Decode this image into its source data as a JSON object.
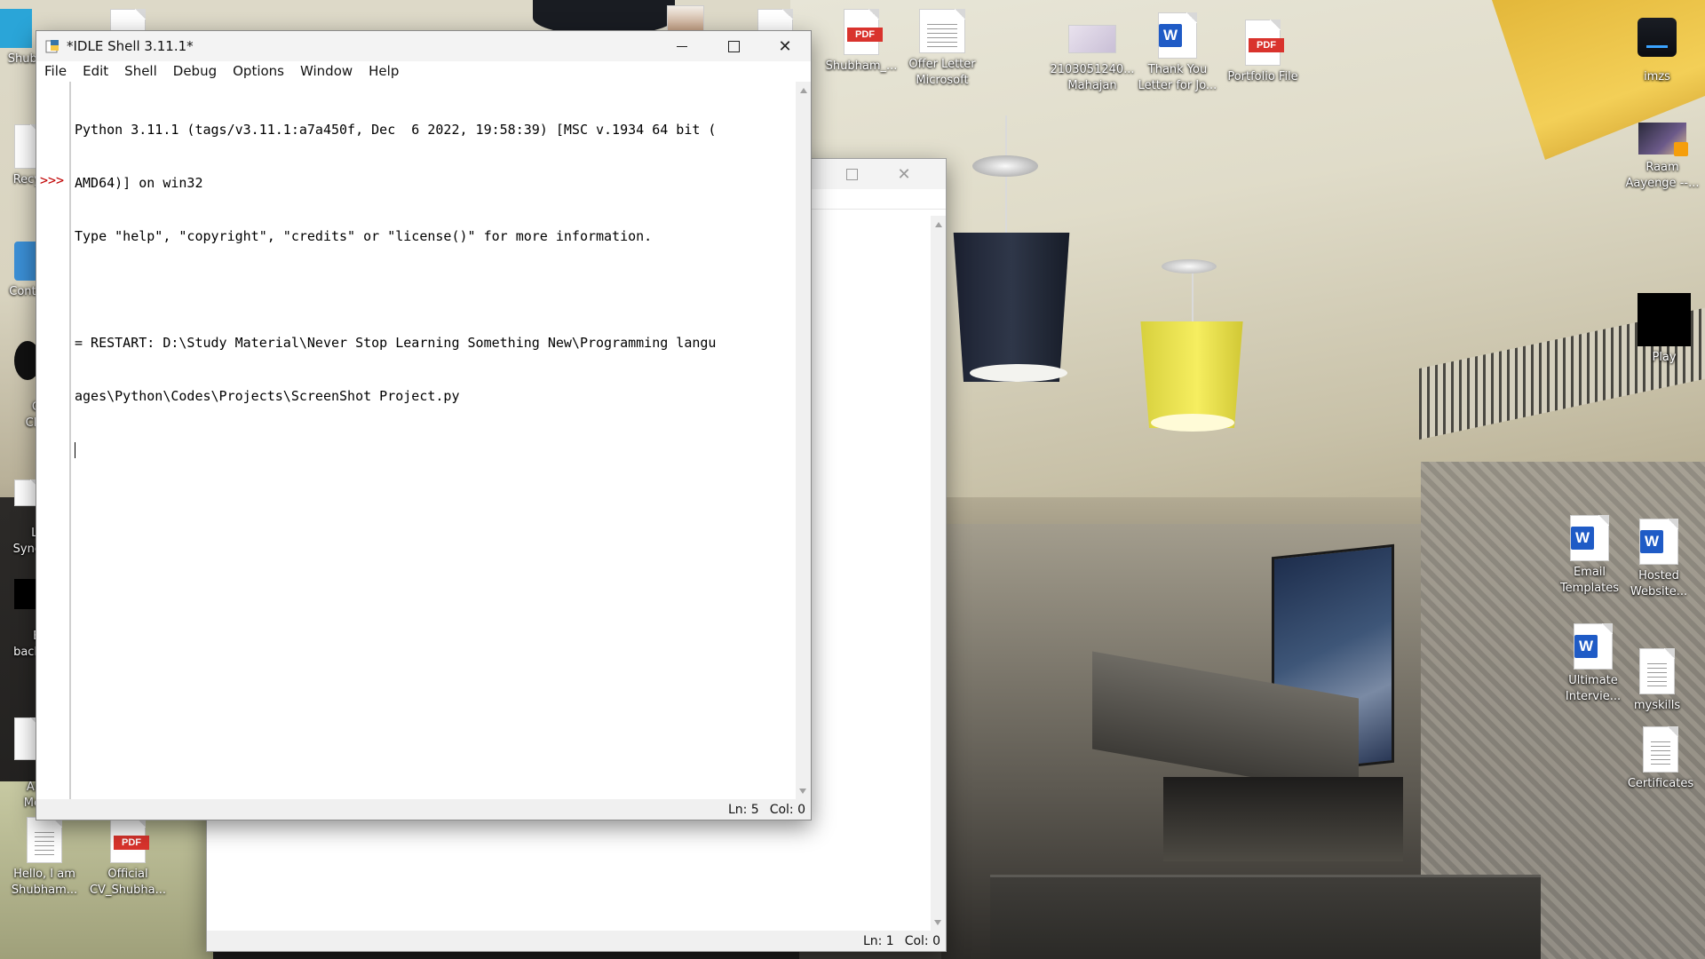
{
  "desktop": {
    "icons": [
      {
        "label": "Shubh",
        "type": "folder-blue"
      },
      {
        "label": "Recy",
        "type": "recycle"
      },
      {
        "label": "Contr",
        "type": "control-panel"
      },
      {
        "label": "G\nCh",
        "type": "shortcut"
      },
      {
        "label": "Li\nSync",
        "type": "app"
      },
      {
        "label": "B\nback",
        "type": "app"
      },
      {
        "label": "All\nMe",
        "type": "doc"
      },
      {
        "label": "Hello, I am Shubham...",
        "type": "doc"
      },
      {
        "label": "Official CV_Shubha...",
        "type": "pdf"
      },
      {
        "label": "Shubham_...",
        "type": "pdf"
      },
      {
        "label": "Offer Letter Microsoft",
        "type": "doc"
      },
      {
        "label": "2103051240... Mahajan",
        "type": "image"
      },
      {
        "label": "Thank You Letter for Jo...",
        "type": "word"
      },
      {
        "label": "Portfolio File",
        "type": "pdf"
      },
      {
        "label": "imzs",
        "type": "drive"
      },
      {
        "label": "Raam Aayenge --...",
        "type": "video"
      },
      {
        "label": "Play",
        "type": "black"
      },
      {
        "label": "Email Templates",
        "type": "word"
      },
      {
        "label": "Hosted Website...",
        "type": "word"
      },
      {
        "label": "Ultimate Intervie...",
        "type": "word"
      },
      {
        "label": "myskills",
        "type": "doc"
      },
      {
        "label": "Certificates",
        "type": "doc"
      }
    ],
    "pdf_badge": "PDF",
    "word_badge": "W"
  },
  "back_window": {
    "status_ln": "Ln: 1",
    "status_col": "Col: 0"
  },
  "idle": {
    "title": "*IDLE Shell 3.11.1*",
    "menu": [
      "File",
      "Edit",
      "Shell",
      "Debug",
      "Options",
      "Window",
      "Help"
    ],
    "prompt": ">>>",
    "lines": [
      "Python 3.11.1 (tags/v3.11.1:a7a450f, Dec  6 2022, 19:58:39) [MSC v.1934 64 bit (",
      "AMD64)] on win32",
      "Type \"help\", \"copyright\", \"credits\" or \"license()\" for more information.",
      "",
      "= RESTART: D:\\Study Material\\Never Stop Learning Something New\\Programming langu",
      "ages\\Python\\Codes\\Projects\\ScreenShot Project.py"
    ],
    "status_ln": "Ln: 5",
    "status_col": "Col: 0"
  }
}
